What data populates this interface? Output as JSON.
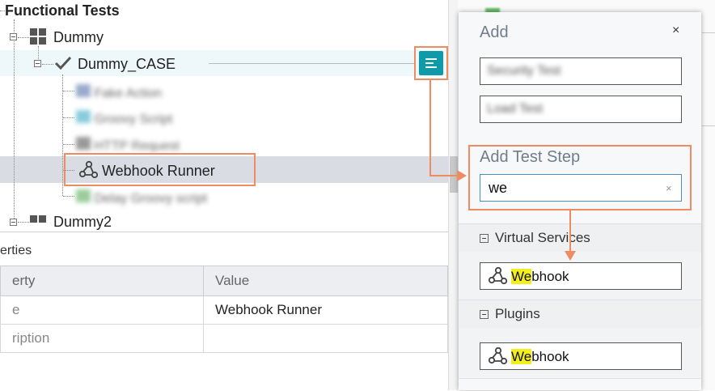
{
  "tree": {
    "root_label": "Functional Tests",
    "suite1_label": "Dummy",
    "case_label": "Dummy_CASE",
    "blurred_steps": [
      "Fake Action",
      "Groovy Script",
      "HTTP Request"
    ],
    "selected_step_label": "Webhook Runner",
    "blurred_last_step": "Delay Groovy script",
    "suite2_label": "Dummy2"
  },
  "properties": {
    "title": "erties",
    "headers": [
      "erty",
      "Value"
    ],
    "rows": [
      {
        "name": "e",
        "value": "Webhook Runner"
      },
      {
        "name": "ription",
        "value": ""
      }
    ]
  },
  "popup": {
    "title": "Add",
    "close_label": "×",
    "add_buttons": [
      "Security Test",
      "Load Test"
    ],
    "add_step_title": "Add Test Step",
    "search_value": "we",
    "clear_label": "×",
    "groups": [
      {
        "label": "Virtual Services",
        "result_highlight": "We",
        "result_rest": "bhook"
      },
      {
        "label": "Plugins",
        "result_highlight": "We",
        "result_rest": "bhook"
      }
    ]
  },
  "colors": {
    "accent_orange": "#ee8b60",
    "menu_teal": "#0e9aa8",
    "match_highlight": "#f4ef1c"
  }
}
